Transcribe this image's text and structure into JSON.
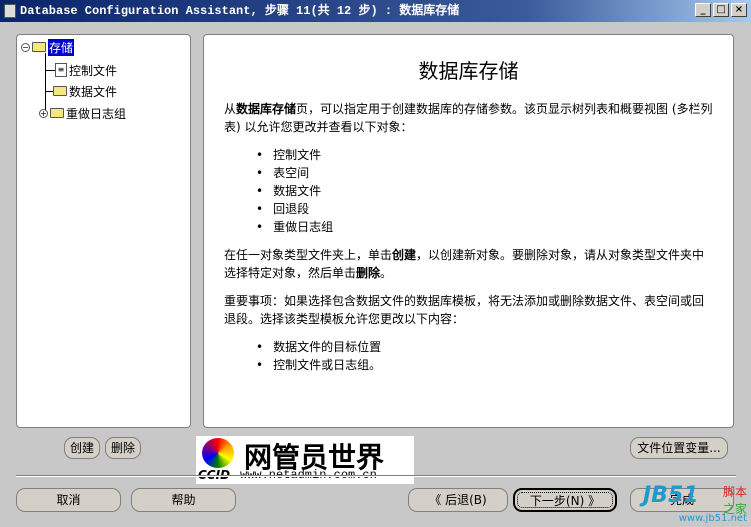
{
  "window": {
    "title": "Database Configuration Assistant, 步骤 11(共 12 步) : 数据库存储",
    "controls": [
      "_",
      "□",
      "×"
    ]
  },
  "tree": {
    "root": "存储",
    "items": [
      "控制文件",
      "数据文件",
      "重做日志组"
    ]
  },
  "content": {
    "title": "数据库存储",
    "intro_prefix": "从",
    "intro_bold": "数据库存储",
    "intro_rest": "页，可以指定用于创建数据库的存储参数。该页显示树列表和概要视图 (多栏列表) 以允许您更改并查看以下对象：",
    "objects": [
      "控制文件",
      "表空间",
      "数据文件",
      "回退段",
      "重做日志组"
    ],
    "create_p1": "在任一对象类型文件夹上，单击",
    "create_bold": "创建",
    "create_p2": "，以创建新对象。要删除对象，请从对象类型文件夹中选择特定对象，然后单击",
    "delete_bold": "删除",
    "create_p3": "。",
    "note": "重要事项：如果选择包含数据文件的数据库模板，将无法添加或删除数据文件、表空间或回退段。选择该类型模板允许您更改以下内容：",
    "changeable": [
      "数据文件的目标位置",
      "控制文件或日志组。"
    ]
  },
  "buttons": {
    "create": "创建",
    "delete": "删除",
    "file_vars": "文件位置变量...",
    "cancel": "取消",
    "help": "帮助",
    "back": "后退(B)",
    "next": "下一步(N)",
    "finish": "完成"
  },
  "logo": {
    "text": "网管员世界",
    "url": "www.netadmin.com.cn",
    "brand": "CCID"
  },
  "watermark": {
    "text": "JB51 脚本之家",
    "url": "www.jb51.net"
  }
}
